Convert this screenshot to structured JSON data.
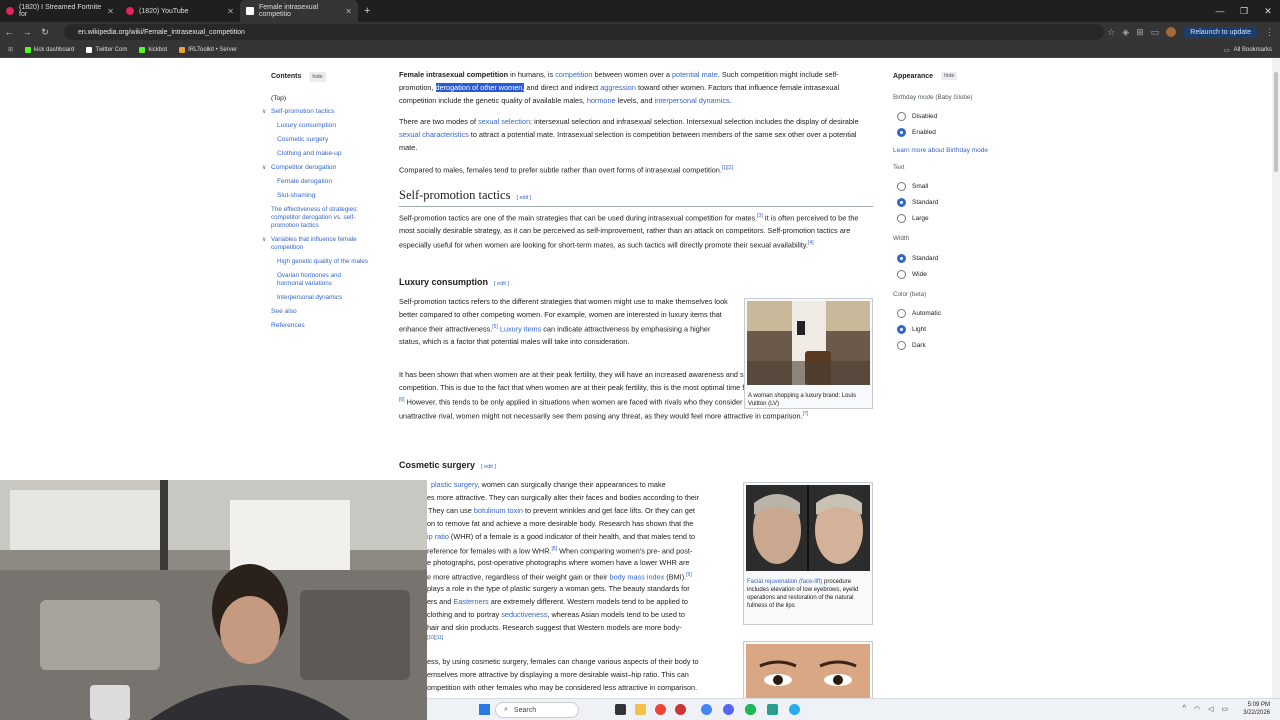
{
  "browser": {
    "tabs": [
      {
        "title": "(1820) I Streamed Fortnite for"
      },
      {
        "title": "(1820) YouTube"
      },
      {
        "title": "Female intrasexual competitio"
      }
    ],
    "new_tab": "+",
    "url": "en.wikipedia.org/wiki/Female_intrasexual_competition",
    "relaunch": "Relaunch to update",
    "bookmarks": [
      {
        "label": "kick dashboard",
        "color": "#53fc18"
      },
      {
        "label": "Twitter Com",
        "color": "#ffffff"
      },
      {
        "label": "kickbot",
        "color": "#53fc18"
      },
      {
        "label": "IRLToolkit • Server",
        "color": "#e8a33b"
      }
    ],
    "all_bookmarks": "All Bookmarks",
    "window_controls": [
      "—",
      "❐",
      "✕"
    ]
  },
  "toc": {
    "title": "Contents",
    "hide": "hide",
    "items": [
      "(Top)",
      "Self-promotion tactics",
      "Luxury consumption",
      "Cosmetic surgery",
      "Clothing and make-up",
      "Competitor derogation",
      "Female derogation",
      "Slut-shaming",
      "The effectiveness of strategies: competitor derogation vs. self-promotion tactics",
      "Variables that influence female competition",
      "High genetic quality of the males",
      "Ovarian hormones and hormonal variations",
      "Interpersonal dynamics",
      "See also",
      "References"
    ]
  },
  "article": {
    "p1": {
      "b": "Female intrasexual competition",
      "t1": " in humans, is ",
      "l1": "competition",
      "t2": " between women over a ",
      "l2": "potential mate",
      "t3": ". Such competition might include self-promotion, ",
      "hl": "derogation of other women,",
      "t4": " and direct and indirect ",
      "l3": "aggression",
      "t5": " toward other women. Factors that influence female intrasexual competition include the genetic quality of available males, ",
      "l4": "hormone",
      "t6": " levels, and ",
      "l5": "interpersonal dynamics",
      "t7": "."
    },
    "p2": {
      "t1": "There are two modes of ",
      "l1": "sexual selection",
      "t2": ": intersexual selection and infrasexual selection. Intersexual selection includes the display of desirable ",
      "l2": "sexual characteristics",
      "t3": " to attract a potential mate. Intrasexual selection is competition between members of the same sex other over a potential mate."
    },
    "p3": {
      "t": "Compared to males, females tend to prefer subtle rather than overt forms of intrasexual competition.",
      "ref": "[1][2]"
    },
    "h_self": "Self-promotion tactics",
    "edit": "[ edit ]",
    "p4": {
      "t1": "Self-promotion tactics are one of the main strategies that can be used during intrasexual competition for mates.",
      "ref1": "[3]",
      "t2": " It is often perceived to be the most socially desirable strategy, as it can be perceived as self-improvement, rather than an attack on competitors. Self-promotion tactics are especially useful for when women are looking for short-term mates, as such tactics will directly promote their sexual availability.",
      "ref2": "[4]"
    },
    "h_luxury": "Luxury consumption",
    "p5": {
      "t1": "Self-promotion tactics refers to the different strategies that women might use to make themselves look better compared to other competing women. For example, women are interested in luxury items that enhance their attractiveness.",
      "ref": "[5]",
      "l1": " Luxury items",
      "t2": " can indicate attractiveness by emphasising a higher status, which is a factor that potential males will take into consideration."
    },
    "p6": {
      "t1": "It has been shown that when women are at their peak fertility, they will have an increased awareness and sensitivity to female intrasexual competition. This is due to the fact that when women are at their peak fertility, this is the most optimal time for them to mate and produce offspring.",
      "ref": "[6]",
      "t2": " However, this tends to be only applied in situations when women are faced with rivals who they consider to be attractive. When with an unattractive rival, women might not necessarily see them posing any threat, as they would feel more attractive in comparison.",
      "ref2": "[7]"
    },
    "h_cosmetic": "Cosmetic surgery",
    "p7": {
      "l1": "plastic surgery",
      "t1": ", women can surgically change their appearances to make",
      "t2": "es more attractive. They can surgically alter their faces and bodies according to their",
      "t3": "They can use ",
      "l2": "botulinum toxin",
      "t4": " to prevent wrinkles and get face lifts. Or they can get",
      "t5": "on to remove fat and achieve a more desirable body. Research has shown that the",
      "l3": "ip ratio",
      "t6": " (WHR) of a female is a good indicator of their health, and that males tend to",
      "t7": "reference for females with a low WHR.",
      "ref1": "[8]",
      "t8": " When comparing women's pre- and post-",
      "t9": "e photographs, post-operative photographs where women have a lower WHR are",
      "t10": "e more attractive, regardless of their weight gain or their ",
      "l4": "body mass index",
      "t11": " (BMI).",
      "ref2": "[9]",
      "t12": "plays a role in the type of plastic surgery a woman gets. The beauty standards for",
      "t13": "ers and ",
      "l5": "Easterners",
      "t14": " are extremely different. Western models tend to be applied to",
      "t15": "clothing and to portray ",
      "l6": "seductiveness",
      "t16": ", whereas Asian models tend to be used to",
      "t17": "hair and skin products. Research suggest that Western models are more body-",
      "ref3": "[10][11]",
      "t18": "ess, by using cosmetic surgery, females can change various aspects of their body to",
      "t19": "emselves more attractive by displaying a more desirable waist–hip ratio. This can",
      "t20": "ompetition with other females who may be considered less attractive in comparison."
    },
    "cap1": "A woman shopping a luxury brand: Louis Vuitton (LV)",
    "cap2": {
      "l": "Facial rejuvenation (face-lift)",
      "t": " procedure includes elevation of low eyebrows, eyelid operations and restoration of the natural fullness of the lips"
    }
  },
  "appearance": {
    "title": "Appearance",
    "hide": "hide",
    "birthday_label": "Birthday mode (Baby Globe)",
    "birthday_opts": [
      "Disabled",
      "Enabled"
    ],
    "birthday_selected": 1,
    "learn_more": "Learn more about Birthday mode",
    "text_label": "Text",
    "text_opts": [
      "Small",
      "Standard",
      "Large"
    ],
    "text_selected": 1,
    "width_label": "Width",
    "width_opts": [
      "Standard",
      "Wide"
    ],
    "width_selected": 0,
    "color_label": "Color (beta)",
    "color_opts": [
      "Automatic",
      "Light",
      "Dark"
    ],
    "color_selected": 1
  },
  "taskbar": {
    "search": "Search",
    "time": "5:09 PM",
    "date": "3/22/2026"
  }
}
